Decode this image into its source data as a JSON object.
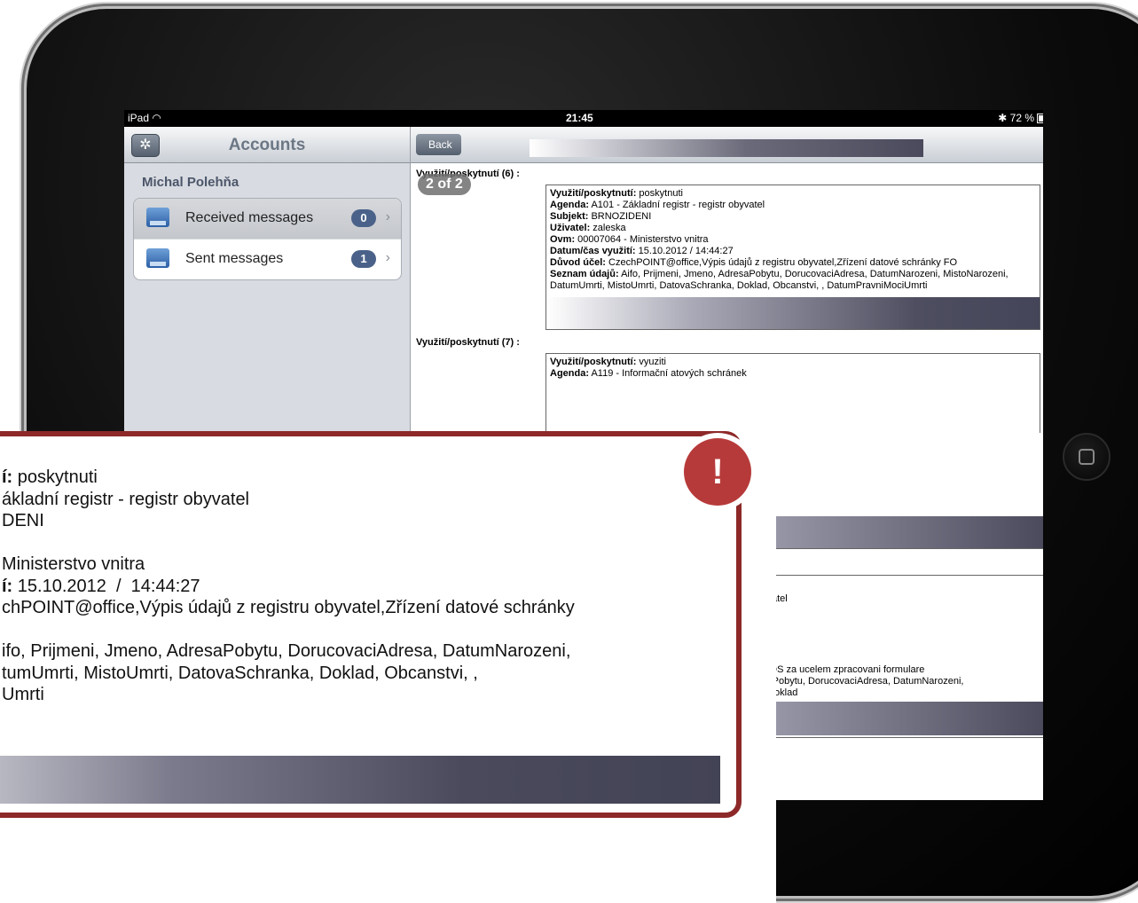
{
  "status": {
    "carrier": "iPad",
    "time": "21:45",
    "battery": "72 %"
  },
  "left": {
    "title": "Accounts",
    "user": "Michal Polehňa",
    "items": [
      {
        "label": "Received messages",
        "count": "0"
      },
      {
        "label": "Sent messages",
        "count": "1"
      }
    ]
  },
  "right": {
    "back": "Back",
    "pager": "2 of 2",
    "section6": "Využití/poskytnutí (6) :",
    "section7": "Využití/poskytnutí (7) :",
    "record6": {
      "l1k": "Využití/poskytnutí:",
      "l1v": " poskytnuti",
      "l2k": "Agenda:",
      "l2v": " A101 - Základní registr - registr obyvatel",
      "l3k": "Subjekt:",
      "l3v": " BRNOZIDENI",
      "l4k": "Uživatel:",
      "l4v": " zaleska",
      "l5k": "Ovm:",
      "l5v": " 00007064 - Ministerstvo vnitra",
      "l6k": "Datum/čas využití:",
      "l6v": " 15.10.2012  /  14:44:27",
      "l7k": "Důvod účel:",
      "l7v": " CzechPOINT@office,Výpis údajů z registru obyvatel,Zřízení datové schránky FO",
      "l8k": "Seznam údajů:",
      "l8v": " Aifo, Prijmeni, Jmeno, AdresaPobytu, DorucovaciAdresa, DatumNarozeni, MistoNarozeni, DatumUmrti, MistoUmrti, DatovaSchranka, Doklad, Obcanstvi, , DatumPravniMociUmrti"
    },
    "record7": {
      "l1k": "Využití/poskytnutí:",
      "l1v": " vyuziti",
      "l2k": "Agenda:",
      "l2v": " A119 - Informační ",
      "l2tail": "atových schránek"
    },
    "frag": {
      "f1": "yvatel",
      "f2": "a DS za ucelem zpracovani formulare",
      "f3": "saPobytu, DorucovaciAdresa, DatumNarozeni,",
      "f4": ", Doklad"
    }
  },
  "zoom": {
    "lines": [
      {
        "k": "í:",
        "v": " poskytnuti"
      },
      {
        "k": "",
        "v": "ákladní registr - registr obyvatel"
      },
      {
        "k": "",
        "v": "DENI"
      },
      {
        "k": "",
        "v": " "
      },
      {
        "k": "",
        "v": "Ministerstvo vnitra"
      },
      {
        "k": "í:",
        "v": " 15.10.2012  /  14:44:27"
      },
      {
        "k": "",
        "v": "chPOINT@office,Výpis údajů z registru obyvatel,Zřízení datové schránky"
      },
      {
        "k": "",
        "v": " "
      },
      {
        "k": "",
        "v": "ifo, Prijmeni, Jmeno, AdresaPobytu, DorucovaciAdresa, DatumNarozeni,"
      },
      {
        "k": "",
        "v": "tumUmrti, MistoUmrti, DatovaSchranka, Doklad, Obcanstvi, ,"
      },
      {
        "k": "",
        "v": "Umrti"
      }
    ],
    "alert": "!"
  }
}
